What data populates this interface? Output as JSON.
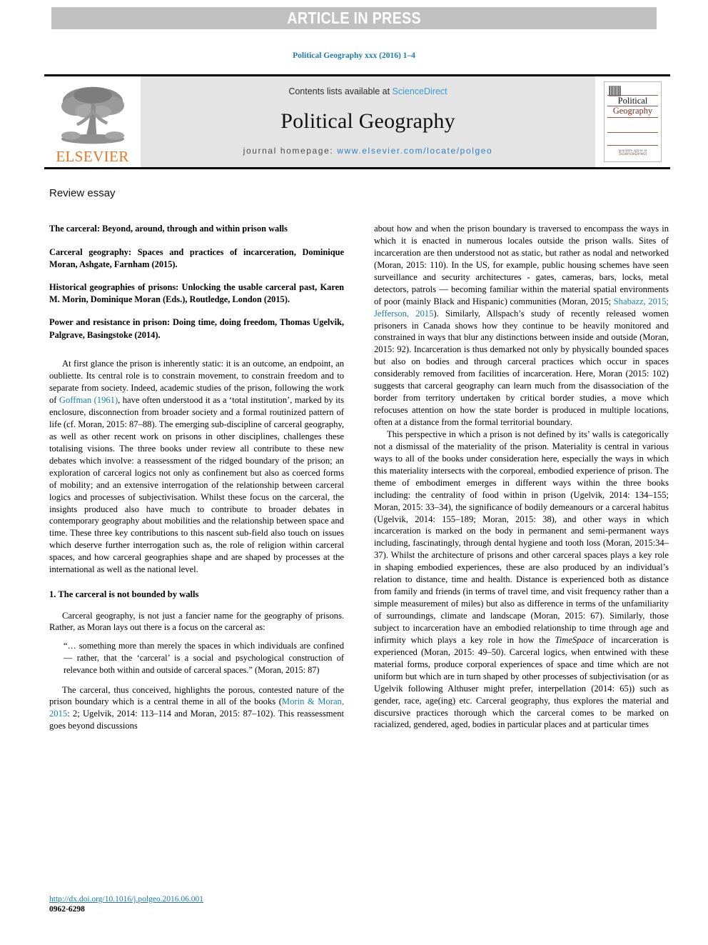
{
  "banner": {
    "text": "ARTICLE IN PRESS"
  },
  "running_head": "Political Geography xxx (2016) 1–4",
  "masthead": {
    "publisher": "ELSEVIER",
    "contents_prefix": "Contents lists available at ",
    "contents_link": "ScienceDirect",
    "journal_title": "Political Geography",
    "homepage_label": "journal homepage: ",
    "homepage_url": "www.elsevier.com/locate/polgeo",
    "cover": {
      "line1": "Political",
      "line2": "Geography",
      "footer_small": "available online at",
      "footer_brand": "ScienceDirect"
    }
  },
  "article_type": "Review essay",
  "left_column": {
    "essay_title": "The carceral: Beyond, around, through and within prison walls",
    "books": [
      "Carceral geography: Spaces and practices of incarceration, Dominique Moran, Ashgate, Farnham (2015).",
      "Historical geographies of prisons: Unlocking the usable carceral past, Karen M. Morin, Dominique Moran (Eds.), Routledge, London (2015).",
      "Power and resistance in prison: Doing time, doing freedom, Thomas Ugelvik, Palgrave, Basingstoke (2014)."
    ],
    "intro_p1_a": "At first glance the prison is inherently static: it is an outcome, an endpoint, an oubliette. Its central role is to constrain movement, to constrain freedom and to separate from society. Indeed, academic studies of the prison, following the work of ",
    "intro_p1_link": "Goffman (1961)",
    "intro_p1_b": ", have often understood it as a ‘total institution’, marked by its enclosure, disconnection from broader society and a formal routinized pattern of life (cf. Moran, 2015: 87–88). The emerging sub-discipline of carceral geography, as well as other recent work on prisons in other disciplines, challenges these totalising visions. The three books under review all contribute to these new debates which involve: a reassessment of the ridged boundary of the prison; an exploration of carceral logics not only as confinement but also as coerced forms of mobility; and an extensive interrogation of the relationship between carceral logics and processes of subjectivisation. Whilst these focus on the carceral, the insights produced also have much to contribute to broader debates in contemporary geography about mobilities and the relationship between space and time. These three key contributions to this nascent sub-field also touch on issues which deserve further interrogation such as, the role of religion within carceral spaces, and how carceral geographies shape and are shaped by processes at the international as well as the national level.",
    "section_heading": "1. The carceral is not bounded by walls",
    "p2": "Carceral geography, is not just a fancier name for the geography of prisons. Rather, as Moran lays out there is a focus on the carceral as:",
    "quote": "“… something more than merely the spaces in which individuals are confined — rather, that the ‘carceral’ is a social and psychological construction of relevance both within and outside of carceral spaces.” (Moran, 2015: 87)",
    "p3_a": "The carceral, thus conceived, highlights the porous, contested nature of the prison boundary which is a central theme in all of the books (",
    "p3_link": "Morin & Moran, 2015",
    "p3_b": ": 2; Ugelvik, 2014: 113–114 and Moran, 2015: 87–102). This reassessment goes beyond discussions"
  },
  "right_column": {
    "p1_a": "about how and when the prison boundary is traversed to encompass the ways in which it is enacted in numerous locales outside the prison walls. Sites of incarceration are then understood not as static, but rather as nodal and networked (Moran, 2015: 110). In the US, for example, public housing schemes have seen surveillance and security architectures - gates, cameras, bars, locks, metal detectors, patrols — becoming familiar within the material spatial environments of poor (mainly Black and Hispanic) communities (Moran, 2015; ",
    "p1_link": "Shabazz, 2015; Jefferson, 2015",
    "p1_b": "). Similarly, Allspach’s study of recently released women prisoners in Canada shows how they continue to be heavily monitored and constrained in ways that blur any distinctions between inside and outside (Moran, 2015: 92). Incarceration is thus demarked not only by physically bounded spaces but also on bodies and through carceral practices which occur in spaces considerably removed from facilities of incarceration. Here, Moran (2015: 102) suggests that carceral geography can learn much from the disassociation of the border from territory undertaken by critical border studies, a move which refocuses attention on how the state border is produced in multiple locations, often at a distance from the formal territorial boundary.",
    "p2_a": "This perspective in which a prison is not defined by its’ walls is categorically not a dismissal of the materiality of the prison. Materiality is central in various ways to all of the books under consideration here, especially the ways in which this materiality intersects with the corporeal, embodied experience of prison. The theme of embodiment emerges in different ways within the three books including: the centrality of food within in prison (Ugelvik, 2014: 134–155; Moran, 2015: 33–34), the significance of bodily demeanours or a carceral habitus (Ugelvik, 2014: 155–189; Moran, 2015: 38), and other ways in which incarceration is marked on the body in permanent and semi-permanent ways including, fascinatingly, through dental hygiene and tooth loss (Moran, 2015:34–37). Whilst the architecture of prisons and other carceral spaces plays a key role in shaping embodied experiences, these are also produced by an individual’s relation to distance, time and health. Distance is experienced both as distance from family and friends (in terms of travel time, and visit frequency rather than a simple measurement of miles) but also as difference in terms of the unfamiliarity of surroundings, climate and landscape (Moran, 2015: 67). Similarly, those subject to incarceration have an embodied relationship to time through age and infirmity which plays a key role in how the ",
    "p2_italic": "TimeSpace",
    "p2_b": " of incarceration is experienced (Moran, 2015: 49–50). Carceral logics, when entwined with these material forms, produce corporal experiences of space and time which are not uniform but which are in turn shaped by other processes of subjectivisation (or as Ugelvik following Althuser might prefer, interpellation (2014: 65)) such as gender, race, age(ing) etc. Carceral geography, thus explores the material and discursive practices thorough which the carceral comes to be marked on racialized, gendered, aged, bodies in particular places and at particular times"
  },
  "footer": {
    "doi": "http://dx.doi.org/10.1016/j.polgeo.2016.06.001",
    "issn": "0962-6298"
  },
  "colors": {
    "link_blue": "#1a7bb0",
    "elsevier_orange": "#e87722",
    "banner_gray": "#c0c0c0",
    "masthead_gray": "#e4e4e4"
  }
}
